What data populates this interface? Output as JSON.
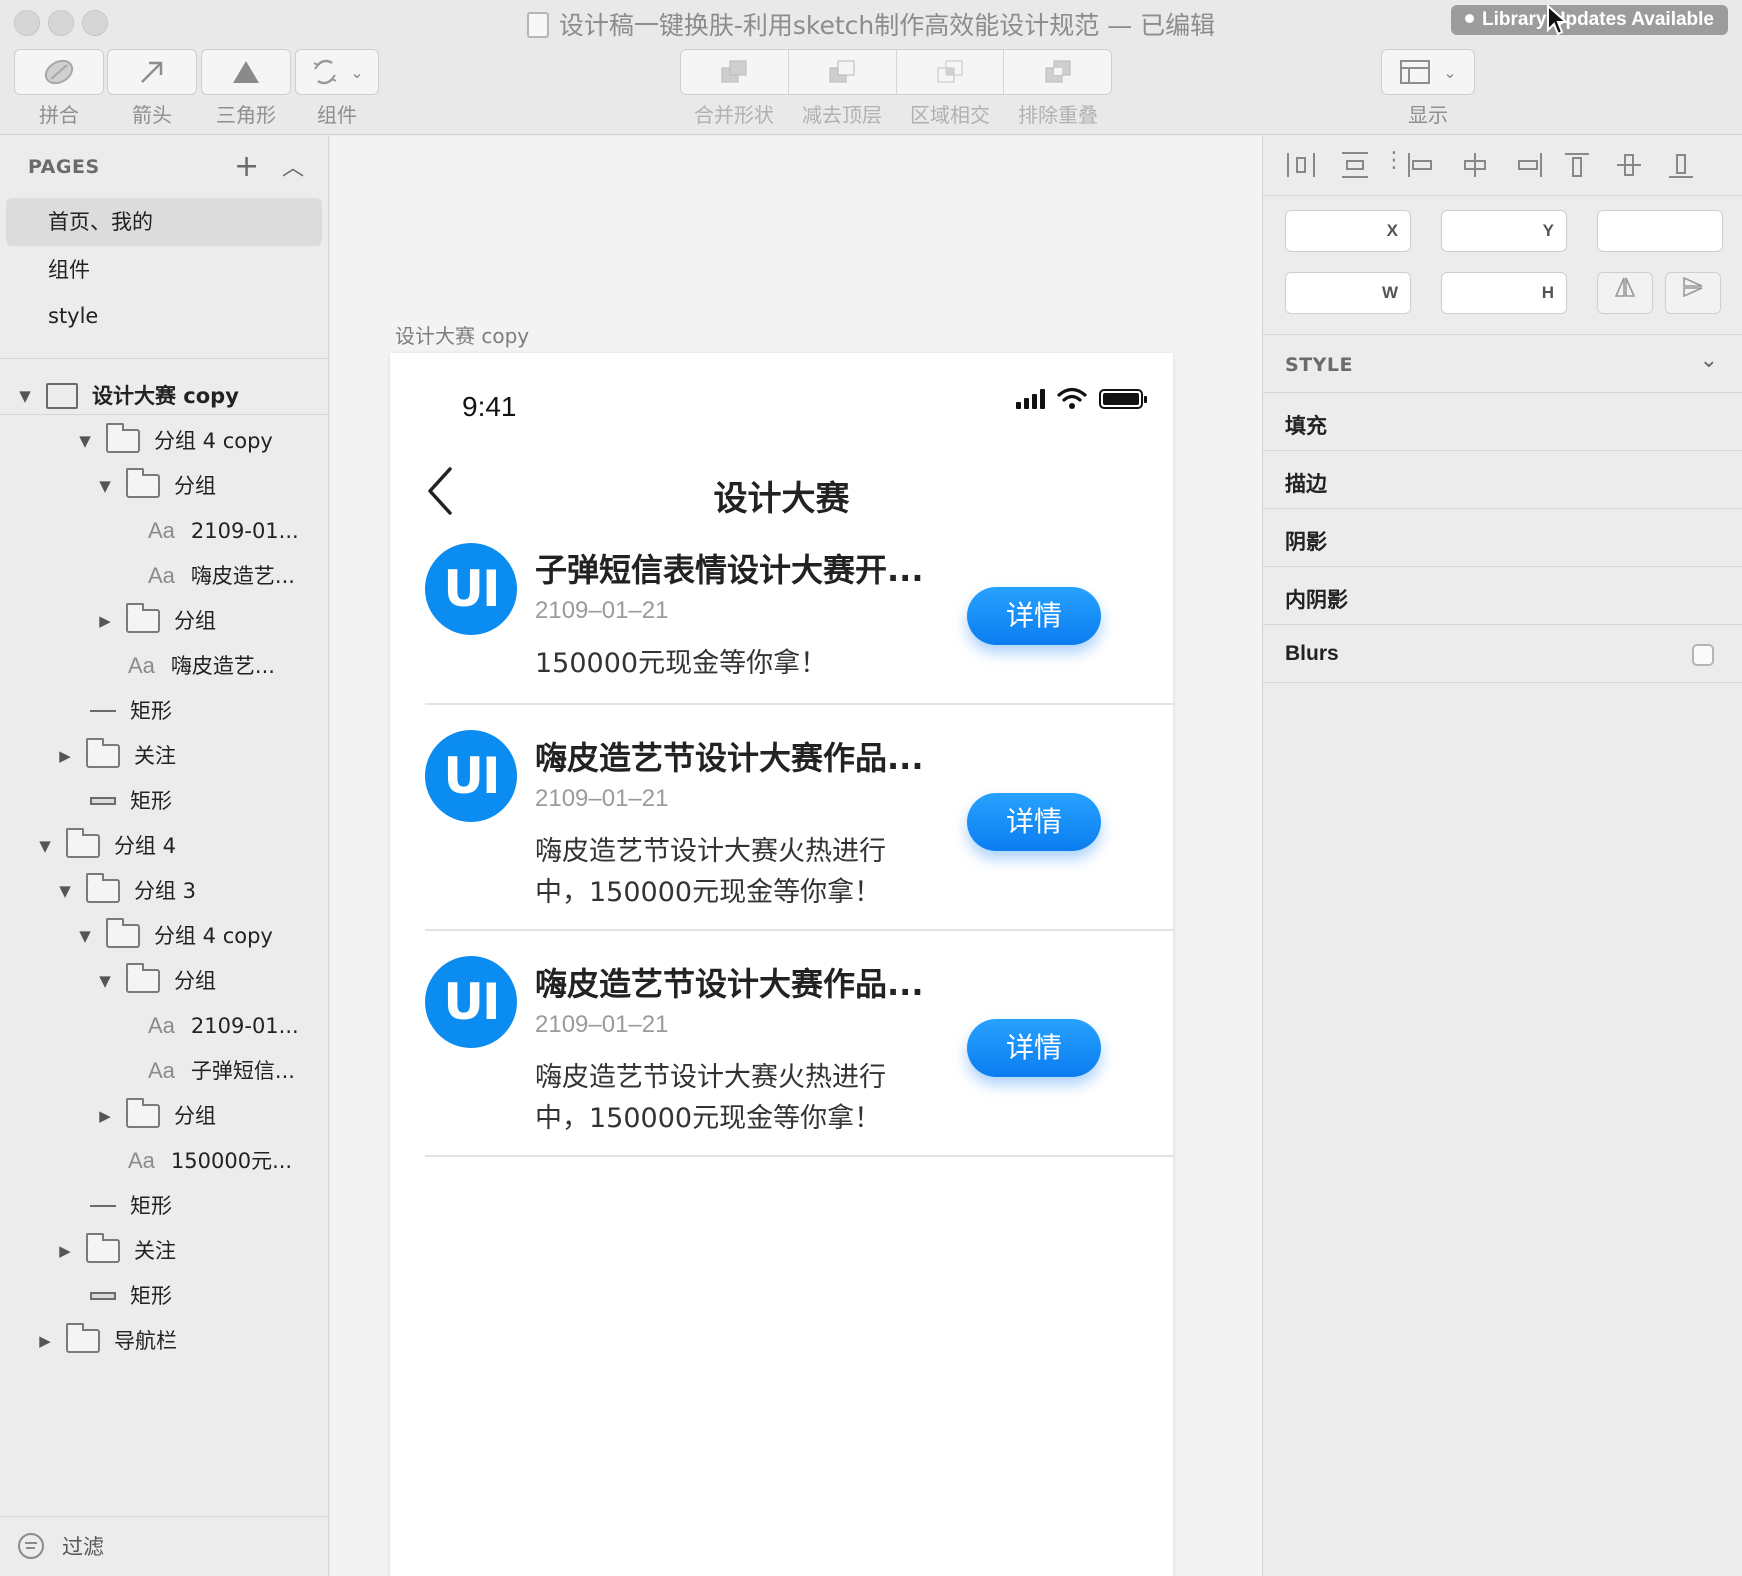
{
  "window": {
    "title": "设计稿一键换肤-利用sketch制作高效能设计规范 — 已编辑",
    "library_badge": "Library Updates Available"
  },
  "toolbar": {
    "union_label": "拼合",
    "arrow_label": "箭头",
    "triangle_label": "三角形",
    "symbol_label": "组件",
    "combine": [
      "合并形状",
      "减去顶层",
      "区域相交",
      "排除重叠"
    ],
    "view_label": "显示"
  },
  "sidebar": {
    "pages_header": "PAGES",
    "pages": [
      "首页、我的",
      "组件",
      "style"
    ],
    "artboard": "设计大赛 copy",
    "layers": [
      "分组 4 copy",
      "分组",
      "2109-01...",
      "嗨皮造艺...",
      "分组",
      "嗨皮造艺...",
      "矩形",
      "关注",
      "矩形",
      "分组 4",
      "分组 3",
      "分组 4 copy",
      "分组",
      "2109-01...",
      "子弹短信...",
      "分组",
      "150000元...",
      "矩形",
      "关注",
      "矩形",
      "导航栏"
    ],
    "filter_label": "过滤"
  },
  "canvas": {
    "artboard_label": "设计大赛 copy",
    "status_time": "9:41",
    "nav_title": "设计大赛",
    "avatar_text": "UI",
    "cards": [
      {
        "title": "子弹短信表情设计大赛开...",
        "date": "2109–01–21",
        "desc": "150000元现金等你拿！",
        "button": "详情"
      },
      {
        "title": "嗨皮造艺节设计大赛作品...",
        "date": "2109–01–21",
        "desc": "嗨皮造艺节设计大赛火热进行中，150000元现金等你拿！",
        "button": "详情"
      },
      {
        "title": "嗨皮造艺节设计大赛作品...",
        "date": "2109–01–21",
        "desc": "嗨皮造艺节设计大赛火热进行中，150000元现金等你拿！",
        "button": "详情"
      }
    ]
  },
  "inspector": {
    "x_label": "X",
    "y_label": "Y",
    "w_label": "W",
    "h_label": "H",
    "style_header": "STYLE",
    "fill": "填充",
    "border": "描边",
    "shadow": "阴影",
    "inner_shadow": "内阴影",
    "blurs": "Blurs"
  },
  "colors": {
    "accent_blue": "#0b8cf0",
    "button_gradient_top": "#27a2ff",
    "button_gradient_bottom": "#0b7df0"
  }
}
